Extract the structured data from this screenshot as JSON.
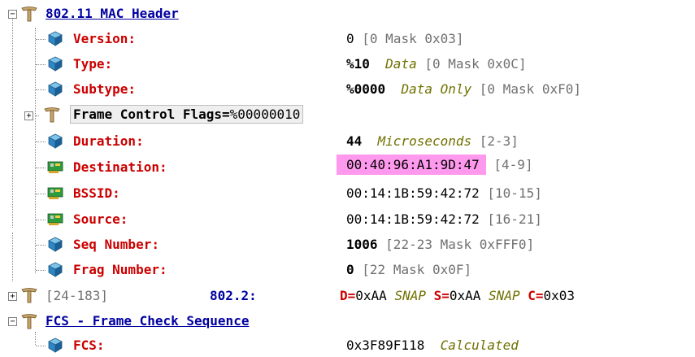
{
  "tree": {
    "mac_header": {
      "title": "802.11 MAC Header",
      "fields": [
        {
          "label": "Version:",
          "value": "0",
          "extra": "[0 Mask 0x03]"
        },
        {
          "label": "Type:",
          "value": "%10",
          "desc": "Data",
          "extra": "[0 Mask 0x0C]"
        },
        {
          "label": "Subtype:",
          "value": "%0000",
          "desc": "Data Only",
          "extra": "[0 Mask 0xF0]"
        },
        {
          "label": "Frame Control Flags=",
          "value": "%00000010"
        },
        {
          "label": "Duration:",
          "value": "44",
          "desc": "Microseconds",
          "extra": "[2-3]"
        },
        {
          "label": "Destination:",
          "value": "00:40:96:A1:9D:47",
          "extra": "[4-9]"
        },
        {
          "label": "BSSID:",
          "value": "00:14:1B:59:42:72",
          "extra": "[10-15]"
        },
        {
          "label": "Source:",
          "value": "00:14:1B:59:42:72",
          "extra": "[16-21]"
        },
        {
          "label": "Seq Number:",
          "value": "1006",
          "extra": "[22-23 Mask 0xFFF0]"
        },
        {
          "label": "Frag Number:",
          "value": "0",
          "extra": "[22 Mask 0x0F]"
        }
      ]
    },
    "llc": {
      "range": "[24-183]",
      "label": "802.2:",
      "d_label": "D=",
      "d_value": "0xAA",
      "d_desc": "SNAP",
      "s_label": "S=",
      "s_value": "0xAA",
      "s_desc": "SNAP",
      "c_label": "C=",
      "c_value": "0x03"
    },
    "fcs_section": {
      "title": "FCS - Frame Check Sequence",
      "field": {
        "label": "FCS:",
        "value": "0x3F89F118",
        "desc": "Calculated"
      }
    }
  },
  "icons": {
    "group": "tree-branch-icon",
    "field": "cube-icon",
    "address": "network-adapter-icon"
  },
  "colors": {
    "label": "#cc0000",
    "header": "#0000a0",
    "unit": "#707000",
    "highlight": "#ff99ee"
  }
}
